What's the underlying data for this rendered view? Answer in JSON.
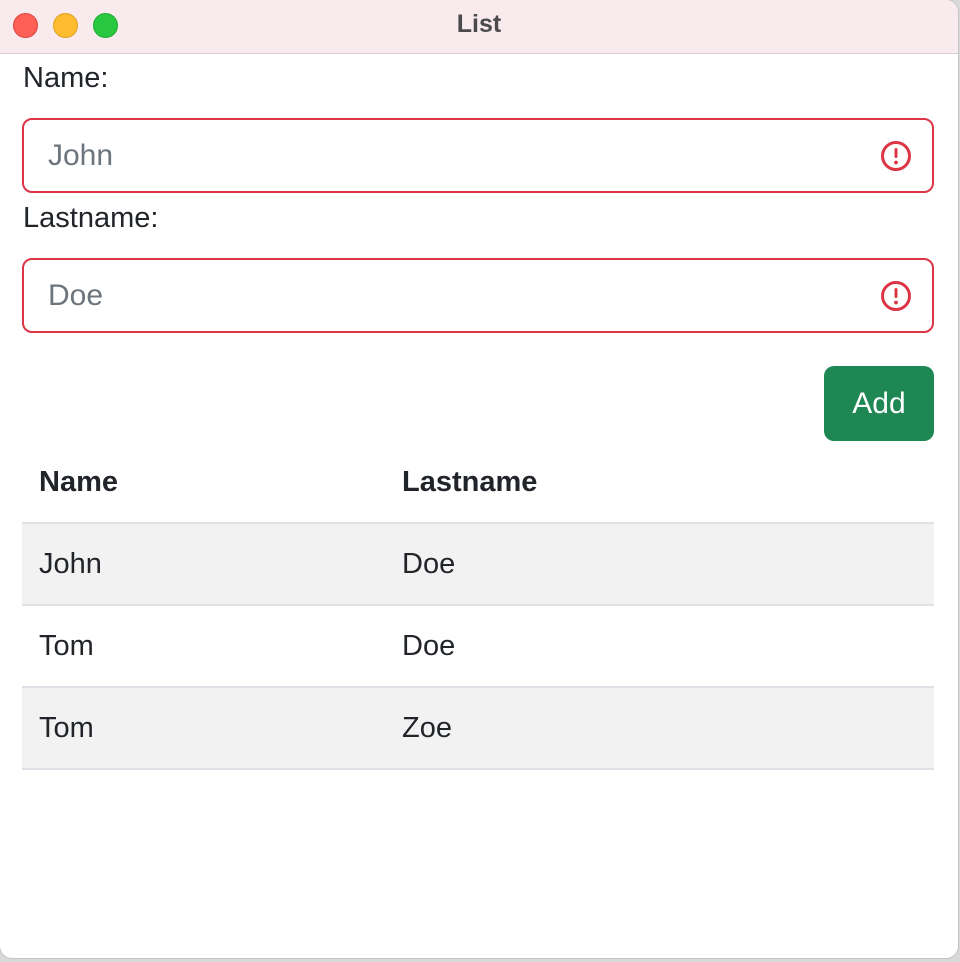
{
  "window": {
    "title": "List"
  },
  "form": {
    "name_label": "Name:",
    "name_placeholder": "John",
    "name_value": "",
    "lastname_label": "Lastname:",
    "lastname_placeholder": "Doe",
    "lastname_value": "",
    "validation_icon": "exclamation-circle-icon",
    "validation_color": "#dc3545",
    "add_label": "Add",
    "add_color": "#1e8754"
  },
  "table": {
    "headers": [
      "Name",
      "Lastname"
    ],
    "rows": [
      [
        "John",
        "Doe"
      ],
      [
        "Tom",
        "Doe"
      ],
      [
        "Tom",
        "Zoe"
      ]
    ]
  }
}
